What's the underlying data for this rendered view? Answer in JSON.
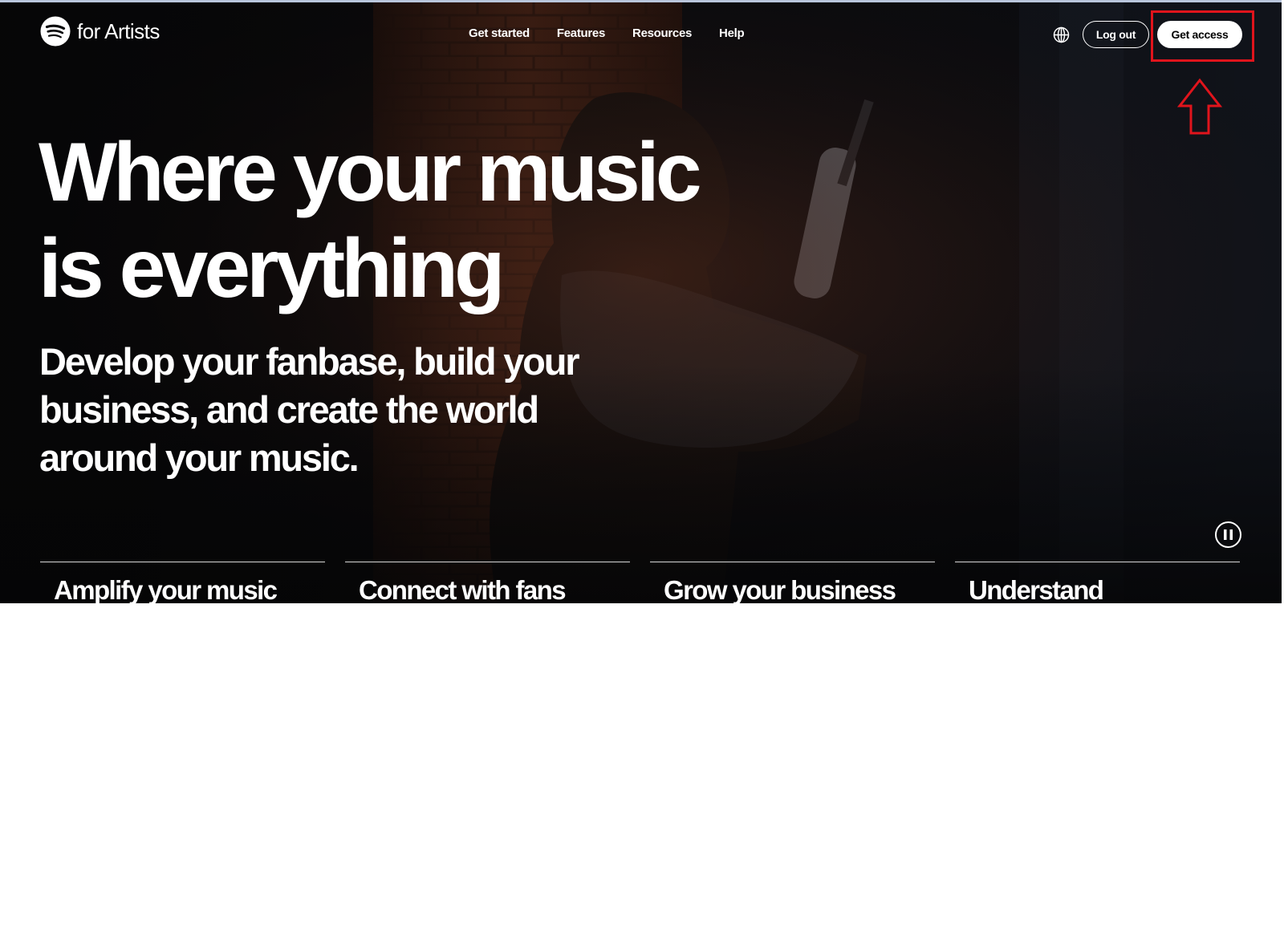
{
  "brand": {
    "name": "for Artists",
    "logo_icon": "spotify-logo-icon"
  },
  "nav": {
    "items": [
      {
        "label": "Get started"
      },
      {
        "label": "Features"
      },
      {
        "label": "Resources"
      },
      {
        "label": "Help"
      }
    ],
    "language_icon": "globe-icon"
  },
  "actions": {
    "logout_label": "Log out",
    "get_access_label": "Get access"
  },
  "annotation": {
    "highlight_color": "#e0141c",
    "arrow_icon": "arrow-up-outline-icon"
  },
  "hero": {
    "headline_line1": "Where your music",
    "headline_line2": "is everything",
    "subhead": "Develop your fanbase, build your business, and create the world around your music.",
    "pause_icon": "pause-icon"
  },
  "feature_tabs": [
    {
      "label": "Amplify your music"
    },
    {
      "label": "Connect with fans"
    },
    {
      "label": "Grow your business"
    },
    {
      "label": "Understand"
    }
  ],
  "colors": {
    "page_background": "#ffffff",
    "hero_background": "#0a0a0c",
    "text": "#ffffff"
  }
}
